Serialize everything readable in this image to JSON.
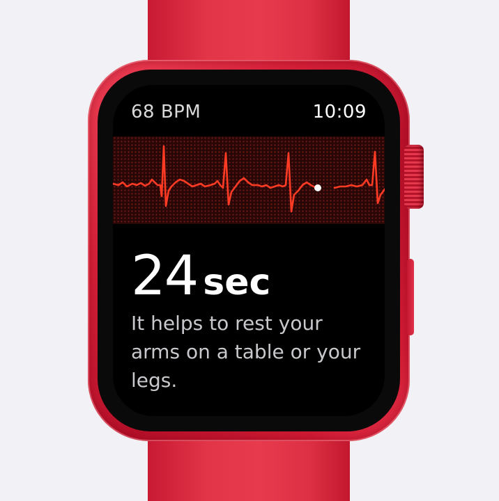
{
  "status_bar": {
    "heart_rate": "68 BPM",
    "time": "10:09"
  },
  "recording": {
    "elapsed_value": "24",
    "elapsed_unit": "sec",
    "tip": "It helps to rest your arms on a table or your legs."
  },
  "colors": {
    "band": "#e23548",
    "case": "#d9213a",
    "ecg_trace": "#ff3b24",
    "ecg_background": "#2a0707",
    "screen": "#000000"
  }
}
